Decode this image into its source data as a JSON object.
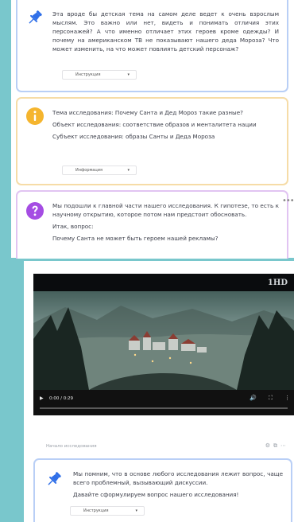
{
  "cards": {
    "card1": {
      "icon": "pin-icon",
      "text": "Эта вроде бы детская тема на самом деле ведет к очень взрослым мыслям. Это важно или нет, видеть и понимать отличия этих персонажей? А что именно отличает этих героев кроме одежды? И почему на американском ТВ не показывают нашего деда Мороза? Что может изменить, на что может повлиять детский персонаж?",
      "dropdown": "Инструкция"
    },
    "card2": {
      "icon": "info-icon",
      "lines": [
        "Тема исследования: Почему Санта и Дед Мороз такие разные?",
        "Объект исследования: соответствие образов и менталитета нации",
        "Субъект исследования: образы Санты и Деда Мороза"
      ],
      "dropdown": "Информация"
    },
    "card3": {
      "icon": "question-icon",
      "lines": [
        "Мы подошли к главной части нашего исследования. К гипотезе, то есть к научному открытию, которое потом нам предстоит обосновать.",
        "Итак, вопрос:",
        "Почему Санта не может быть героем нашей рекламы?"
      ]
    },
    "card4": {
      "icon": "pin-icon",
      "lines": [
        "Мы помним, что в основе любого исследования лежит вопрос, чаще всего проблемный, вызывающий дискуссии.",
        "Давайте сформулируем вопрос нашего исследования!"
      ],
      "dropdown": "Инструкция"
    }
  },
  "video": {
    "time": "0:00 / 0:29",
    "channel_logo": "1HD"
  },
  "section": {
    "title": "Начало исследования"
  },
  "colors": {
    "background": "#79c7cc",
    "pin": "#2f6fe8",
    "info": "#f5b52e",
    "question": "#a54de3"
  }
}
